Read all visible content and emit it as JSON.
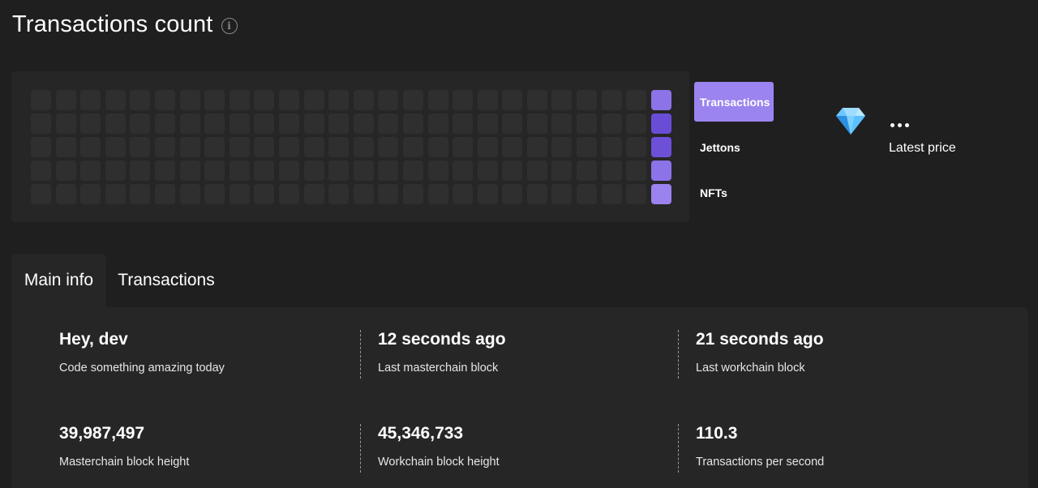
{
  "header": {
    "title": "Transactions count"
  },
  "heatmap": {
    "rows": 5,
    "cols": 26,
    "base_color": "#2f2f2f",
    "active_column": 26,
    "active_colors": [
      "#8c73e8",
      "#6a4dd6",
      "#6d4fd8",
      "#8c73e8",
      "#9b82ee"
    ]
  },
  "chart_tabs": [
    {
      "label": "Transactions",
      "active": true
    },
    {
      "label": "Jettons",
      "active": false
    },
    {
      "label": "NFTs",
      "active": false
    }
  ],
  "price": {
    "icon": "diamond-icon",
    "value_loading": "more-dots-icon",
    "label": "Latest price"
  },
  "info_tabs": [
    {
      "label": "Main info",
      "active": true
    },
    {
      "label": "Transactions",
      "active": false
    }
  ],
  "stats": [
    {
      "value": "Hey, dev",
      "label": "Code something amazing today"
    },
    {
      "value": "12 seconds ago",
      "label": "Last masterchain block"
    },
    {
      "value": "21 seconds ago",
      "label": "Last workchain block"
    },
    {
      "value": "39,987,497",
      "label": "Masterchain block height"
    },
    {
      "value": "45,346,733",
      "label": "Workchain block height"
    },
    {
      "value": "110.3",
      "label": "Transactions per second"
    }
  ],
  "colors": {
    "accent": "#9b84ef",
    "background": "#1f1f1f",
    "panel": "#262626"
  }
}
